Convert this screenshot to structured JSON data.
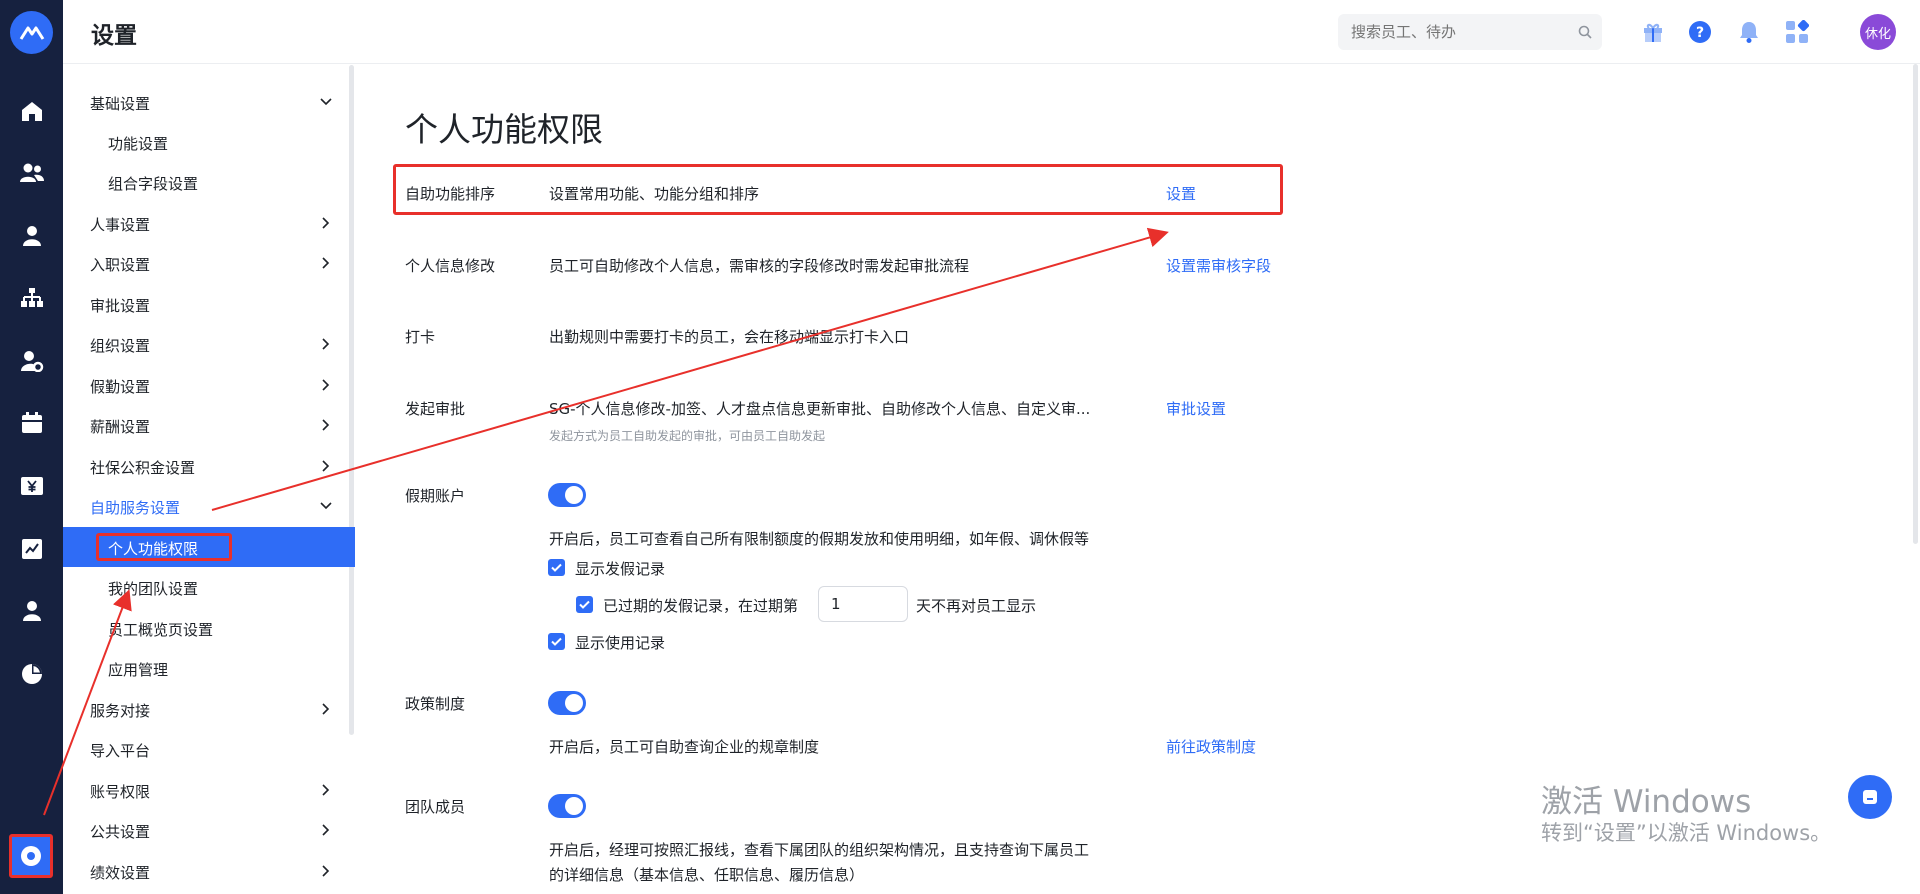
{
  "header": {
    "page_title": "设置",
    "search_placeholder": "搜索员工、待办",
    "avatar_text": "休化"
  },
  "rail_icons": [
    "app-logo-icon",
    "home-icon",
    "team-icon",
    "person-icon",
    "org-chart-icon",
    "user-settings-icon",
    "calendar-icon",
    "salary-icon",
    "report-icon",
    "profile-icon",
    "pie-chart-icon",
    "settings-icon"
  ],
  "sidebar": {
    "items": [
      {
        "label": "基础设置",
        "chevron": "down"
      },
      {
        "label": "功能设置",
        "sub": true
      },
      {
        "label": "组合字段设置",
        "sub": true
      },
      {
        "label": "人事设置",
        "chevron": "right"
      },
      {
        "label": "入职设置",
        "chevron": "right"
      },
      {
        "label": "审批设置"
      },
      {
        "label": "组织设置",
        "chevron": "right"
      },
      {
        "label": "假勤设置",
        "chevron": "right"
      },
      {
        "label": "薪酬设置",
        "chevron": "right"
      },
      {
        "label": "社保公积金设置",
        "chevron": "right"
      },
      {
        "label": "自助服务设置",
        "chevron": "down",
        "expanded": true
      },
      {
        "label": "个人功能权限",
        "sub": true,
        "active": true
      },
      {
        "label": "我的团队设置",
        "sub": true
      },
      {
        "label": "员工概览页设置",
        "sub": true
      },
      {
        "label": "应用管理",
        "sub": true
      },
      {
        "label": "服务对接",
        "chevron": "right"
      },
      {
        "label": "导入平台"
      },
      {
        "label": "账号权限",
        "chevron": "right"
      },
      {
        "label": "公共设置",
        "chevron": "right"
      },
      {
        "label": "绩效设置",
        "chevron": "right"
      }
    ]
  },
  "main": {
    "title": "个人功能权限",
    "sort": {
      "label": "自助功能排序",
      "desc": "设置常用功能、功能分组和排序",
      "link": "设置"
    },
    "info_edit": {
      "label": "个人信息修改",
      "desc": "员工可自助修改个人信息，需审核的字段修改时需发起审批流程",
      "link": "设置需审核字段"
    },
    "clock": {
      "label": "打卡",
      "desc": "出勤规则中需要打卡的员工，会在移动端显示打卡入口"
    },
    "approval": {
      "label": "发起审批",
      "desc": "SG-个人信息修改-加签、人才盘点信息更新审批、自助修改个人信息、自定义审...",
      "hint": "发起方式为员工自助发起的审批，可由员工自助发起",
      "link": "审批设置"
    },
    "leave": {
      "label": "假期账户",
      "enabled": true,
      "desc": "开启后，员工可查看自己所有限制额度的假期发放和使用明细，如年假、调休假等",
      "show_grant": "显示发假记录",
      "expired_prefix": "已过期的发假记录，在过期第",
      "expired_days": "1",
      "expired_suffix": "天不再对员工显示",
      "show_usage": "显示使用记录"
    },
    "policy": {
      "label": "政策制度",
      "enabled": true,
      "desc": "开启后，员工可自助查询企业的规章制度",
      "link": "前往政策制度"
    },
    "team": {
      "label": "团队成员",
      "enabled": true,
      "desc_line1": "开启后，经理可按照汇报线，查看下属团队的组织架构情况，且支持查询下属员工",
      "desc_line2": "的详细信息（基本信息、任职信息、履历信息）"
    }
  },
  "watermark": {
    "line1": "激活 Windows",
    "line2": "转到“设置”以激活 Windows。"
  },
  "colors": {
    "rail": "#16213f",
    "accent": "#2f6cf6",
    "highlight": "#e8302b"
  }
}
